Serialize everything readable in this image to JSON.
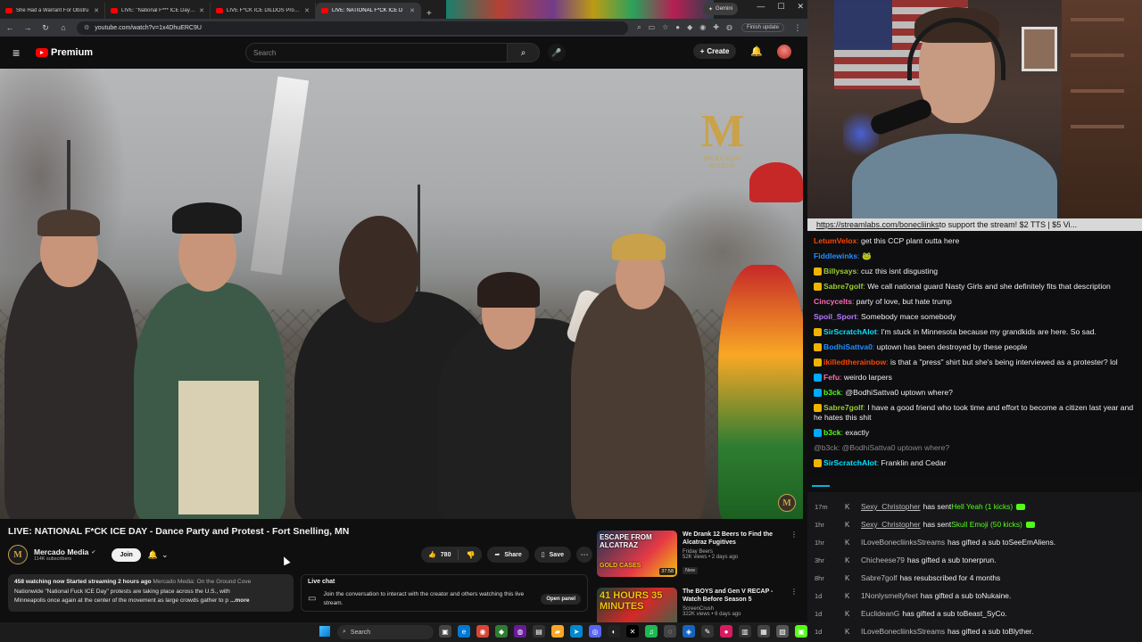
{
  "browser": {
    "tabs": [
      {
        "title": "She Had a Warrant For Obstru",
        "active": false
      },
      {
        "title": "LIVE: \"National F*** ICE Day\" P",
        "active": false
      },
      {
        "title": "LIVE F*CK ICE DILDOS Protest",
        "active": false
      },
      {
        "title": "LIVE: NATIONAL F*CK ICE D",
        "active": true
      }
    ],
    "new_tab": "+",
    "gemini_label": "Gemini",
    "url": "youtube.com/watch?v=1x4DhuERC9U",
    "finish_update": "Finish update"
  },
  "youtube": {
    "logo_text": "Premium",
    "search_placeholder": "Search",
    "create_label": "Create",
    "video": {
      "watermark_text": "MERCADO MEDIA"
    },
    "title": "LIVE: NATIONAL F*CK ICE DAY - Dance Party and Protest - Fort Snelling, MN",
    "channel": {
      "name": "Mercado Media",
      "subscribers": "114K subscribers",
      "join_label": "Join"
    },
    "actions": {
      "likes": "780",
      "share": "Share",
      "save": "Save"
    },
    "description": {
      "stats": "458 watching now  Started streaming 2 hours ago",
      "muted": "Mercado Media: On the Ground Cove",
      "line2": "Nationwide \"National Fuck ICE Day\" protests are taking place across the U.S., with",
      "line3": "Minneapolis once again at the center of the movement as large crowds gather to p",
      "more": "...more"
    },
    "live_chat": {
      "title": "Live chat",
      "text": "Join the conversation to interact with the creator and others watching this live stream.",
      "open_panel": "Open panel"
    },
    "recommendations": [
      {
        "thumb_text": "ESCAPE FROM ALCATRAZ",
        "thumb_sub": "GOLD CASES",
        "duration": "37:58",
        "title": "We Drank 12 Beers to Find the Alcatraz Fugitives",
        "channel": "Friday Beers",
        "stats": "52K views • 2 days ago",
        "badge": "New"
      },
      {
        "thumb_text": "41 HOURS 35 MINUTES",
        "duration": "",
        "title": "The BOYS and Gen V RECAP - Watch Before Season 5",
        "channel": "ScreenCrush",
        "stats": "322K views • 6 days ago",
        "badge": ""
      }
    ]
  },
  "stream": {
    "promo_link": "https://streamlabs.com/bonecliinks",
    "promo_rest": " to support the stream! $2 TTS | $5 Vi...",
    "chat": [
      {
        "user": "LetumVelox",
        "color": "#ff4500",
        "text": " get this CCP plant outta here",
        "badge": ""
      },
      {
        "user": "Fiddlewinks",
        "color": "#1e90ff",
        "text": " 🐸",
        "badge": ""
      },
      {
        "user": "Billysays",
        "color": "#9acd32",
        "text": " cuz this isnt disgusting",
        "badge": "#f0b400"
      },
      {
        "user": "Sabre7golf",
        "color": "#9acd32",
        "text": " We call national guard Nasty Girls and she definitely fits that description",
        "badge": "#f0b400"
      },
      {
        "user": "Cincycelts",
        "color": "#ff69b4",
        "text": " party of love, but hate trump",
        "badge": ""
      },
      {
        "user": "Spoil_Sport",
        "color": "#b57bff",
        "text": " Somebody mace somebody",
        "badge": ""
      },
      {
        "user": "SirScratchAlot",
        "color": "#00e5ff",
        "text": " I'm stuck in Minnesota because my grandkids are here. So sad.",
        "badge": "#f0b400"
      },
      {
        "user": "BodhiSattva0",
        "color": "#1e90ff",
        "text": " uptown has been destroyed by these people",
        "badge": "#f0b400"
      },
      {
        "user": "ikilledtherainbow",
        "color": "#ff4500",
        "text": " is that a \"press\" shirt but she's being interviewed as a protester? lol",
        "badge": "#f0b400"
      },
      {
        "user": "Fefu",
        "color": "#ff69b4",
        "text": " weirdo larpers",
        "badge": "#00aaff"
      },
      {
        "user": "b3ck",
        "color": "#53fc18",
        "text": " @BodhiSattva0 uptown where?",
        "badge": "#00aaff"
      },
      {
        "user": "Sabre7golf",
        "color": "#9acd32",
        "text": " I have a good friend who took time and effort to become a citizen last year and he hates this shit",
        "badge": "#f0b400"
      },
      {
        "user": "b3ck",
        "color": "#53fc18",
        "text": " exactly",
        "badge": "#00aaff"
      },
      {
        "user": "",
        "color": "#888",
        "text": "@b3ck: @BodhiSattva0 uptown where?",
        "badge": "",
        "faded": true
      },
      {
        "user": "SirScratchAlot",
        "color": "#00e5ff",
        "text": " Franklin and Cedar",
        "badge": "#f0b400"
      }
    ],
    "events": [
      {
        "time": "17m",
        "user": "Sexy_Christopher",
        "action": " has sent ",
        "item": "Hell Yeah (1 kicks)",
        "gem": true
      },
      {
        "time": "1hr",
        "user": "Sexy_Christopher",
        "action": " has sent ",
        "item": "Skull Emoji (50 kicks)",
        "gem": true
      },
      {
        "time": "1hr",
        "user": "ILoveBonecliinksStreams",
        "action": " has gifted a sub to ",
        "item": "SeeEmAliens.",
        "gem": false
      },
      {
        "time": "3hr",
        "user": "Chicheese79",
        "action": " has gifted a sub to ",
        "item": "nerprun.",
        "gem": false
      },
      {
        "time": "8hr",
        "user": "Sabre7golf",
        "action": " has resubscribed for 4 months",
        "item": "",
        "gem": false
      },
      {
        "time": "1d",
        "user": "1Nonlysmellyfeet",
        "action": " has gifted a sub to ",
        "item": "Nukaine.",
        "gem": false
      },
      {
        "time": "1d",
        "user": "EuclideanG",
        "action": " has gifted a sub to ",
        "item": "Beast_SyCo.",
        "gem": false
      },
      {
        "time": "1d",
        "user": "ILoveBonecliinksStreams",
        "action": " has gifted a sub to ",
        "item": "Blyther.",
        "gem": false
      }
    ]
  },
  "taskbar": {
    "search_label": "Search"
  },
  "colors": {
    "yt_red": "#ff0000",
    "kick_green": "#53fc18",
    "bg": "#0f0f0f"
  }
}
